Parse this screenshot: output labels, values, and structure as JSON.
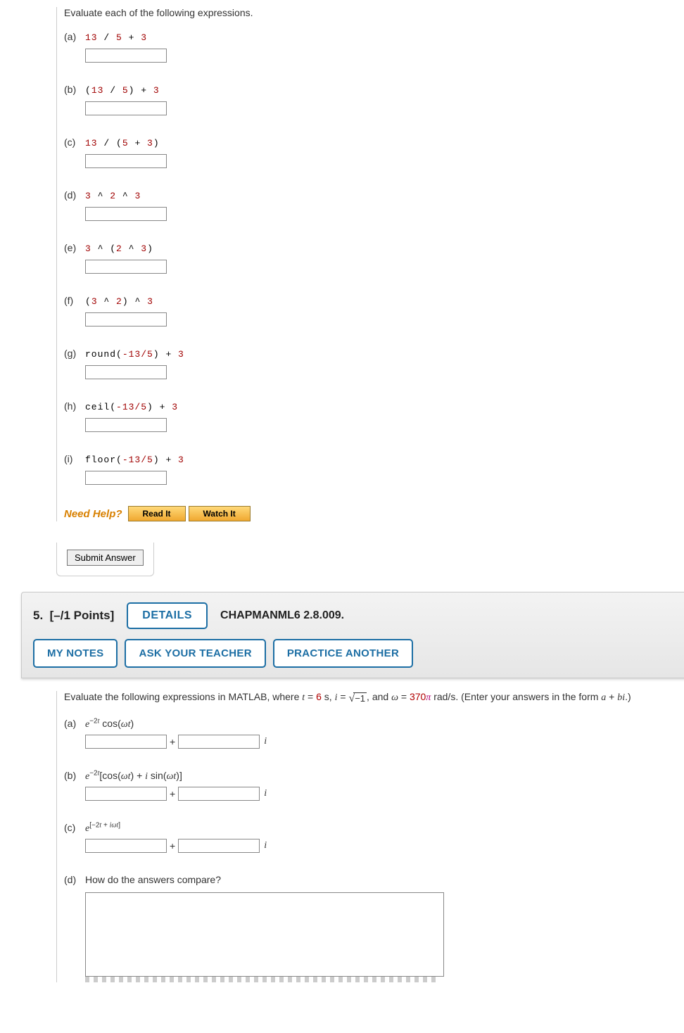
{
  "q4": {
    "prompt": "Evaluate each of the following expressions.",
    "parts": [
      {
        "label": "(a)",
        "tokens": [
          {
            "t": "13",
            "c": "red"
          },
          {
            "t": " / ",
            "c": "black"
          },
          {
            "t": "5",
            "c": "red"
          },
          {
            "t": " + ",
            "c": "black"
          },
          {
            "t": "3",
            "c": "red"
          }
        ]
      },
      {
        "label": "(b)",
        "tokens": [
          {
            "t": "(",
            "c": "black"
          },
          {
            "t": "13",
            "c": "red"
          },
          {
            "t": " / ",
            "c": "black"
          },
          {
            "t": "5",
            "c": "red"
          },
          {
            "t": ")",
            "c": "black"
          },
          {
            "t": " + ",
            "c": "black"
          },
          {
            "t": "3",
            "c": "red"
          }
        ]
      },
      {
        "label": "(c)",
        "tokens": [
          {
            "t": "13",
            "c": "red"
          },
          {
            "t": " / ",
            "c": "black"
          },
          {
            "t": "(",
            "c": "black"
          },
          {
            "t": "5",
            "c": "red"
          },
          {
            "t": " + ",
            "c": "black"
          },
          {
            "t": "3",
            "c": "red"
          },
          {
            "t": ")",
            "c": "black"
          }
        ]
      },
      {
        "label": "(d)",
        "tokens": [
          {
            "t": "3",
            "c": "red"
          },
          {
            "t": " ^ ",
            "c": "black"
          },
          {
            "t": "2",
            "c": "red"
          },
          {
            "t": " ^ ",
            "c": "black"
          },
          {
            "t": "3",
            "c": "red"
          }
        ]
      },
      {
        "label": "(e)",
        "tokens": [
          {
            "t": "3",
            "c": "red"
          },
          {
            "t": " ^ ",
            "c": "black"
          },
          {
            "t": "(",
            "c": "black"
          },
          {
            "t": "2",
            "c": "red"
          },
          {
            "t": " ^ ",
            "c": "black"
          },
          {
            "t": "3",
            "c": "red"
          },
          {
            "t": ")",
            "c": "black"
          }
        ]
      },
      {
        "label": "(f)",
        "tokens": [
          {
            "t": "(",
            "c": "black"
          },
          {
            "t": "3",
            "c": "red"
          },
          {
            "t": " ^ ",
            "c": "black"
          },
          {
            "t": "2",
            "c": "red"
          },
          {
            "t": ")",
            "c": "black"
          },
          {
            "t": " ^ ",
            "c": "black"
          },
          {
            "t": "3",
            "c": "red"
          }
        ]
      },
      {
        "label": "(g)",
        "tokens": [
          {
            "t": "round(",
            "c": "black"
          },
          {
            "t": "-13/5",
            "c": "red"
          },
          {
            "t": ")",
            "c": "black"
          },
          {
            "t": " + ",
            "c": "black"
          },
          {
            "t": "3",
            "c": "red"
          }
        ]
      },
      {
        "label": "(h)",
        "tokens": [
          {
            "t": "ceil(",
            "c": "black"
          },
          {
            "t": "-13/5",
            "c": "red"
          },
          {
            "t": ")",
            "c": "black"
          },
          {
            "t": " + ",
            "c": "black"
          },
          {
            "t": "3",
            "c": "red"
          }
        ]
      },
      {
        "label": "(i)",
        "tokens": [
          {
            "t": "floor(",
            "c": "black"
          },
          {
            "t": "-13/5",
            "c": "red"
          },
          {
            "t": ")",
            "c": "black"
          },
          {
            "t": " + ",
            "c": "black"
          },
          {
            "t": "3",
            "c": "red"
          }
        ]
      }
    ],
    "need_help": "Need Help?",
    "read_it": "Read It",
    "watch_it": "Watch It",
    "submit": "Submit Answer"
  },
  "q5": {
    "header_num": "5.",
    "points": "[–/1 Points]",
    "details": "DETAILS",
    "source": "CHAPMANML6 2.8.009.",
    "my_notes": "MY NOTES",
    "ask_teacher": "ASK YOUR TEACHER",
    "practice_another": "PRACTICE ANOTHER",
    "prompt_pre": "Evaluate the following expressions in MATLAB, where ",
    "t_eq": " = ",
    "t_val": "6",
    "s_comma": " s, ",
    "i_eq": " = ",
    "sqrt_neg1": "−1",
    "and_text": ", and ",
    "omega_eq": " = ",
    "omega_val": "370",
    "pi_sym": "π",
    "rad_text": " rad/s. (Enter your answers in the form ",
    "a_plus_bi": " + ",
    "end_paren": ".)",
    "parts": {
      "a": {
        "label": "(a)"
      },
      "b": {
        "label": "(b)"
      },
      "c": {
        "label": "(c)"
      },
      "d": {
        "label": "(d)",
        "text": "How do the answers compare?"
      }
    },
    "i_suffix": "i",
    "plus": "+"
  }
}
